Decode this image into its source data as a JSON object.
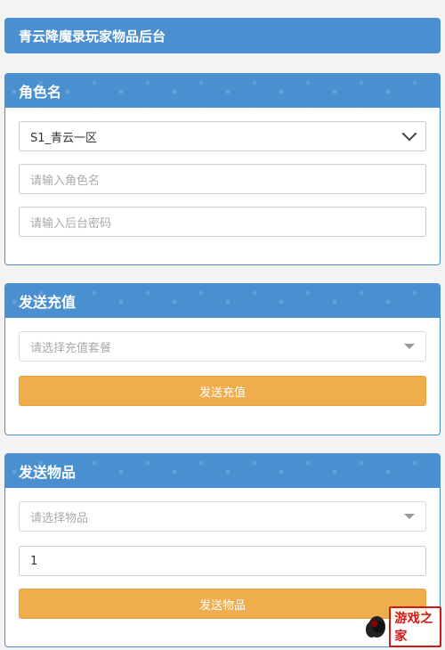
{
  "app": {
    "title": "青云降魔录玩家物品后台"
  },
  "role_panel": {
    "title": "角色名",
    "server_select": {
      "value": "S1_青云一区"
    },
    "role_name_input": {
      "placeholder": "请输入角色名"
    },
    "password_input": {
      "placeholder": "请输入后台密码"
    }
  },
  "recharge_panel": {
    "title": "发送充值",
    "package_select": {
      "placeholder": "请选择充值套餐"
    },
    "submit_button": "发送充值"
  },
  "item_panel": {
    "title": "发送物品",
    "item_select": {
      "placeholder": "请选择物品"
    },
    "quantity_input": {
      "value": "1"
    },
    "submit_button": "发送物品"
  },
  "watermark": {
    "text": "游戏之家"
  },
  "colors": {
    "primary": "#4a8fcf",
    "accent": "#f0ad4e",
    "background": "#f3f3f3"
  }
}
